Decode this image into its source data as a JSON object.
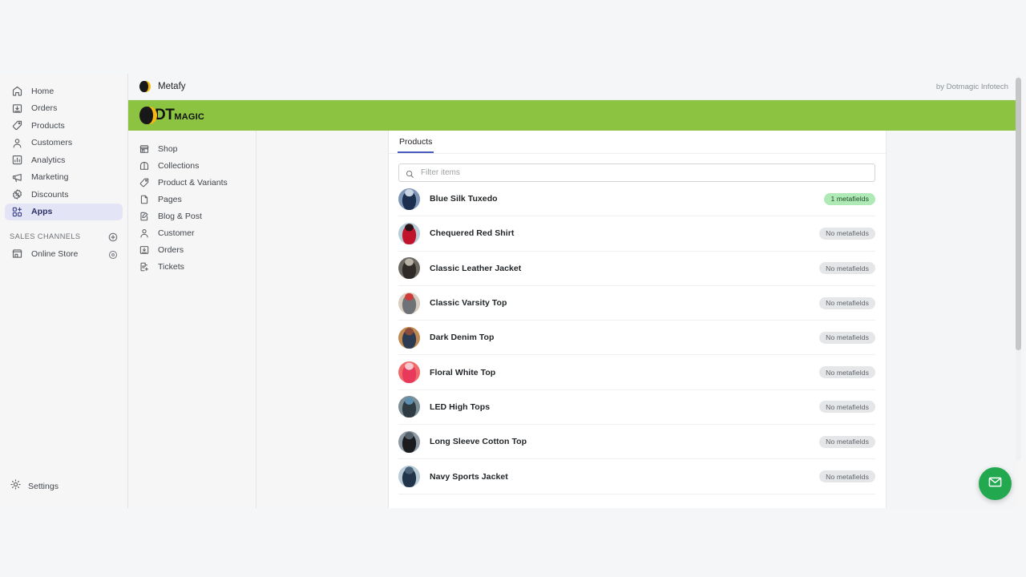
{
  "sidebar": {
    "items": [
      {
        "label": "Home",
        "icon": "home-icon",
        "active": false
      },
      {
        "label": "Orders",
        "icon": "orders-icon",
        "active": false
      },
      {
        "label": "Products",
        "icon": "products-tag-icon",
        "active": false
      },
      {
        "label": "Customers",
        "icon": "customers-icon",
        "active": false
      },
      {
        "label": "Analytics",
        "icon": "analytics-icon",
        "active": false
      },
      {
        "label": "Marketing",
        "icon": "marketing-megaphone-icon",
        "active": false
      },
      {
        "label": "Discounts",
        "icon": "discounts-icon",
        "active": false
      },
      {
        "label": "Apps",
        "icon": "apps-icon",
        "active": true
      }
    ],
    "sales_channels_heading": "SALES CHANNELS",
    "add_channel_icon": "plus-circle-icon",
    "channels": [
      {
        "label": "Online Store",
        "icon": "storefront-icon",
        "action_icon": "eye-icon"
      }
    ],
    "settings": {
      "label": "Settings",
      "icon": "gear-icon"
    }
  },
  "app_titlebar": {
    "logo_icon": "metafy-moon-logo",
    "app_name": "Metafy",
    "credit": "by Dotmagic Infotech"
  },
  "brand_band": {
    "logo_icon": "dotmagic-moon-logo",
    "brand_primary": "DT",
    "brand_secondary": "MAGIC",
    "color": "#8cc442"
  },
  "app_nav": {
    "items": [
      {
        "label": "Shop",
        "icon": "shop-icon"
      },
      {
        "label": "Collections",
        "icon": "collections-icon"
      },
      {
        "label": "Product & Variants",
        "icon": "product-tag-icon"
      },
      {
        "label": "Pages",
        "icon": "page-icon"
      },
      {
        "label": "Blog & Post",
        "icon": "blog-pencil-icon"
      },
      {
        "label": "Customer",
        "icon": "customer-icon"
      },
      {
        "label": "Orders",
        "icon": "orders-icon"
      },
      {
        "label": "Tickets",
        "icon": "ticket-add-icon"
      }
    ]
  },
  "content": {
    "tabs": [
      {
        "label": "Products",
        "selected": true
      }
    ],
    "search": {
      "placeholder": "Filter items",
      "value": "",
      "icon": "search-icon"
    },
    "badge_colors": {
      "has": "#aee9b6",
      "none": "#e4e6e8"
    },
    "products": [
      {
        "name": "Blue Silk Tuxedo",
        "badge": "1 metafields",
        "has_metafields": true,
        "thumb_colors": [
          "#7e97b8",
          "#1d2f4e",
          "#c9d4e2"
        ]
      },
      {
        "name": "Chequered Red Shirt",
        "badge": "No metafields",
        "has_metafields": false,
        "thumb_colors": [
          "#b7cdd8",
          "#c1142c",
          "#2a1418"
        ]
      },
      {
        "name": "Classic Leather Jacket",
        "badge": "No metafields",
        "has_metafields": false,
        "thumb_colors": [
          "#6d6a63",
          "#2e2b28",
          "#b9b2a6"
        ]
      },
      {
        "name": "Classic Varsity Top",
        "badge": "No metafields",
        "has_metafields": false,
        "thumb_colors": [
          "#d9cdc0",
          "#6f7378",
          "#cf3a3a"
        ]
      },
      {
        "name": "Dark Denim Top",
        "badge": "No metafields",
        "has_metafields": false,
        "thumb_colors": [
          "#c08a52",
          "#2c3b52",
          "#8a4a3c"
        ]
      },
      {
        "name": "Floral White Top",
        "badge": "No metafields",
        "has_metafields": false,
        "thumb_colors": [
          "#f06a6a",
          "#e8395c",
          "#f5c9cd"
        ]
      },
      {
        "name": "LED High Tops",
        "badge": "No metafields",
        "has_metafields": false,
        "thumb_colors": [
          "#7d8f96",
          "#2e3b42",
          "#5c8fb0"
        ]
      },
      {
        "name": "Long Sleeve Cotton Top",
        "badge": "No metafields",
        "has_metafields": false,
        "thumb_colors": [
          "#8e9aa4",
          "#1c1c1e",
          "#55616b"
        ]
      },
      {
        "name": "Navy Sports Jacket",
        "badge": "No metafields",
        "has_metafields": false,
        "thumb_colors": [
          "#b9ccd8",
          "#22344a",
          "#4a6277"
        ]
      }
    ]
  },
  "chat_fab": {
    "icon": "envelope-icon",
    "color": "#22a94f"
  },
  "scrollbar": {
    "orientation": "vertical"
  }
}
